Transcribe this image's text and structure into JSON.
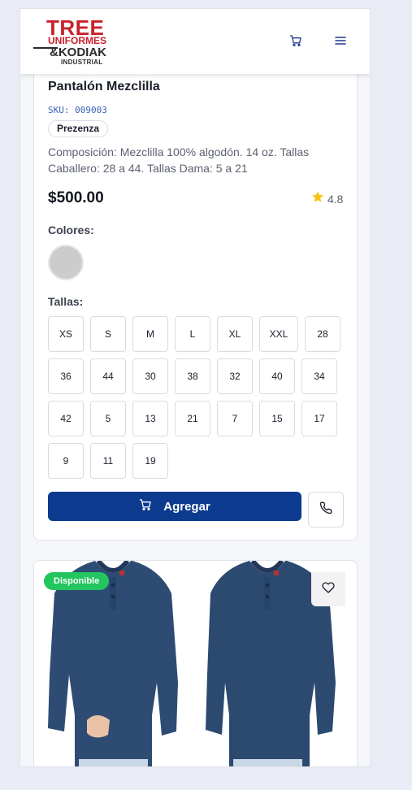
{
  "header": {
    "logo": {
      "line1": "TREE",
      "line2": "UNIFORMES",
      "line3": "&KODIAK",
      "line4": "INDUSTRIAL"
    },
    "icons": [
      "cart-icon",
      "menu-icon"
    ]
  },
  "product": {
    "title": "Pantalón Mezclilla",
    "sku": "SKU: 009003",
    "brand": "Prezenza",
    "description": "Composición: Mezclilla 100% algodón. 14 oz. Tallas Caballero: 28 a 44. Tallas Dama: 5 a 21",
    "price": "$500.00",
    "rating": "4.8",
    "colors_label": "Colores:",
    "color_swatch": "#cccccc",
    "sizes_label": "Tallas:",
    "sizes": [
      "XS",
      "S",
      "M",
      "L",
      "XL",
      "XXL",
      "28",
      "36",
      "44",
      "30",
      "38",
      "32",
      "40",
      "34",
      "42",
      "5",
      "13",
      "21",
      "7",
      "15",
      "17",
      "9",
      "11",
      "19"
    ],
    "add_label": "Agregar"
  },
  "next_product": {
    "badge": "Disponible"
  },
  "colors": {
    "accent": "#0b3a8f",
    "brand_red": "#c8222b",
    "available": "#22c55e",
    "star": "#f5c518"
  }
}
